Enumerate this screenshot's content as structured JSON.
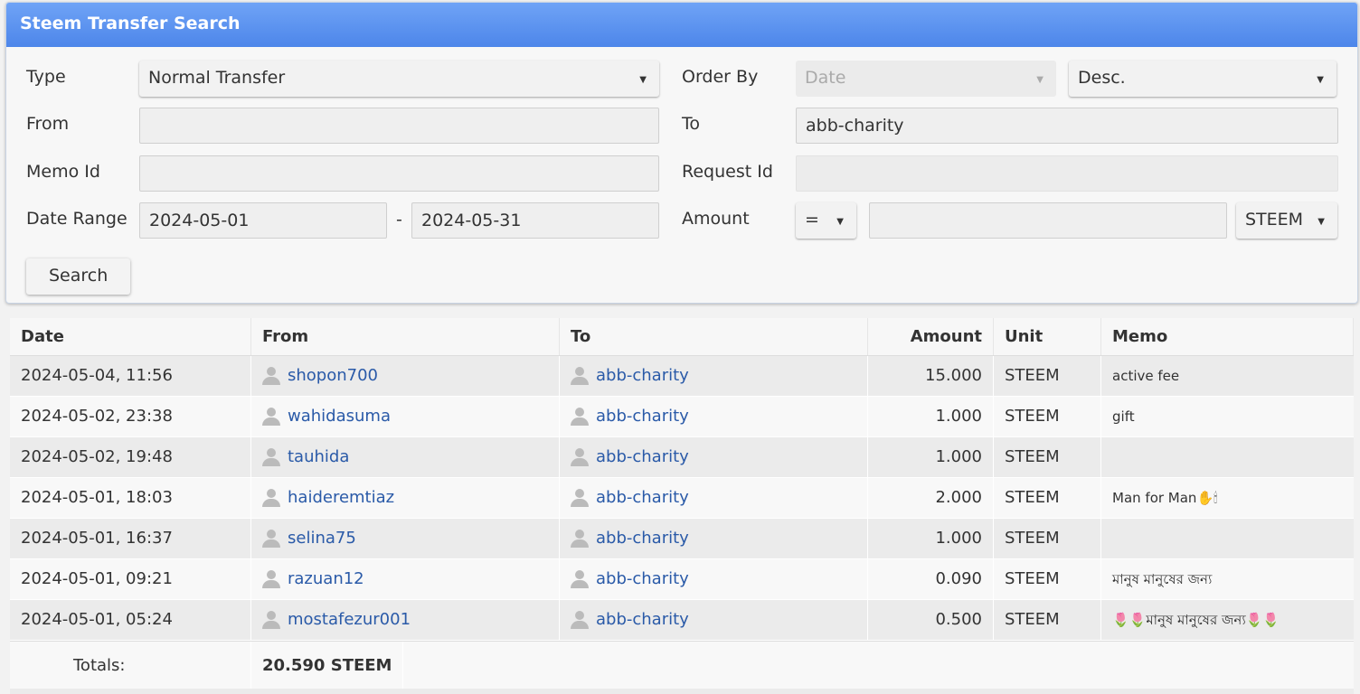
{
  "panel": {
    "title": "Steem Transfer Search"
  },
  "form": {
    "type_label": "Type",
    "type_value": "Normal Transfer",
    "order_by_label": "Order By",
    "order_by_value": "Date",
    "order_dir_value": "Desc.",
    "from_label": "From",
    "from_value": "",
    "to_label": "To",
    "to_value": "abb-charity",
    "memo_id_label": "Memo Id",
    "memo_id_value": "",
    "request_id_label": "Request Id",
    "request_id_value": "",
    "date_range_label": "Date Range",
    "date_from": "2024-05-01",
    "date_sep": "-",
    "date_to": "2024-05-31",
    "amount_label": "Amount",
    "amount_op": "=",
    "amount_value": "",
    "amount_unit": "STEEM",
    "search_label": "Search"
  },
  "table": {
    "headers": {
      "date": "Date",
      "from": "From",
      "to": "To",
      "amount": "Amount",
      "unit": "Unit",
      "memo": "Memo"
    },
    "rows": [
      {
        "date": "2024-05-04, 11:56",
        "from": "shopon700",
        "to": "abb-charity",
        "amount": "15.000",
        "unit": "STEEM",
        "memo": "active fee"
      },
      {
        "date": "2024-05-02, 23:38",
        "from": "wahidasuma",
        "to": "abb-charity",
        "amount": "1.000",
        "unit": "STEEM",
        "memo": "gift"
      },
      {
        "date": "2024-05-02, 19:48",
        "from": "tauhida",
        "to": "abb-charity",
        "amount": "1.000",
        "unit": "STEEM",
        "memo": ""
      },
      {
        "date": "2024-05-01, 18:03",
        "from": "haideremtiaz",
        "to": "abb-charity",
        "amount": "2.000",
        "unit": "STEEM",
        "memo": "Man for Man✋🕯"
      },
      {
        "date": "2024-05-01, 16:37",
        "from": "selina75",
        "to": "abb-charity",
        "amount": "1.000",
        "unit": "STEEM",
        "memo": ""
      },
      {
        "date": "2024-05-01, 09:21",
        "from": "razuan12",
        "to": "abb-charity",
        "amount": "0.090",
        "unit": "STEEM",
        "memo": "মানুষ মানুষের জন্য"
      },
      {
        "date": "2024-05-01, 05:24",
        "from": "mostafezur001",
        "to": "abb-charity",
        "amount": "0.500",
        "unit": "STEEM",
        "memo": "🌷🌷মানুষ মানুষের জন্য🌷🌷"
      }
    ],
    "totals_label": "Totals:",
    "totals_value": "20.590 STEEM"
  },
  "icons": {
    "user": "person-icon",
    "dropdown": "caret-down-icon"
  }
}
